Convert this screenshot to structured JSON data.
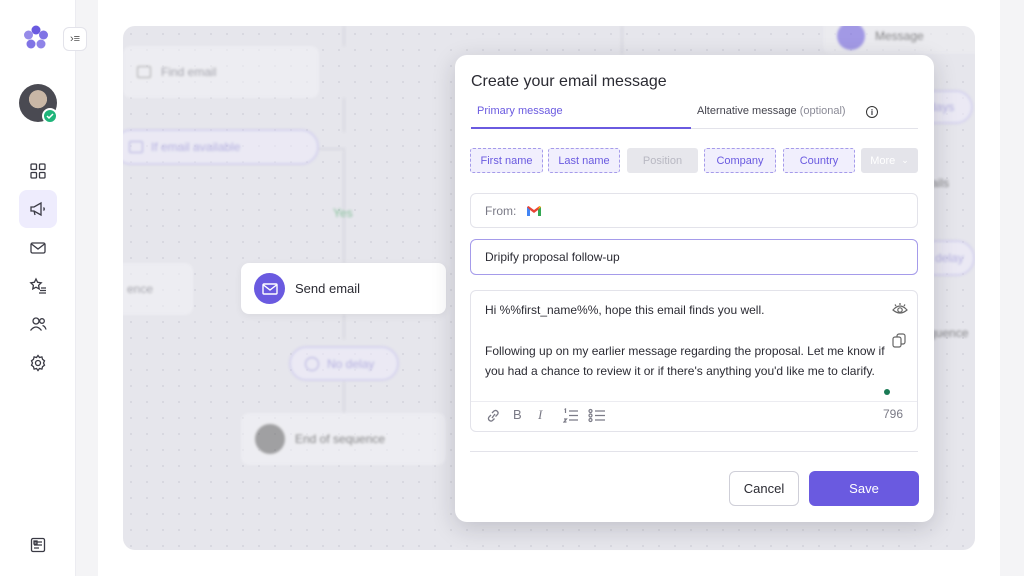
{
  "sidebar": {
    "collapse_glyph": "›≡",
    "nav": [
      "dashboard-icon",
      "megaphone-icon",
      "mail-icon",
      "star-list-icon",
      "users-icon",
      "gear-icon"
    ],
    "bottom": "report-icon"
  },
  "workflow": {
    "find_email": "Find email",
    "if_email_available": "If email available",
    "yes": "Yes",
    "sequence_left": "ence",
    "send_email": "Send email",
    "no_delay": "No delay",
    "end_of_sequence": "End of sequence",
    "right_message": "Message",
    "right_days": "days",
    "right_ails": "ails",
    "right_delay": "delay",
    "right_sequence": "quence"
  },
  "modal": {
    "title": "Create your email message",
    "tabs": {
      "primary": "Primary message",
      "alternative": "Alternative message",
      "alternative_opt": "(optional)",
      "info": "i"
    },
    "chips": [
      "First name",
      "Last name",
      "Position",
      "Company",
      "Country",
      "More"
    ],
    "from_label": "From:",
    "subject": "Dripify proposal follow-up",
    "body_line1": "Hi %%first_name%%, hope this email finds you well.",
    "body_line2": "Following up on my earlier message regarding the proposal. Let me know if you had a chance to review it or if there's anything you'd like me to clarify.",
    "char_count": "796",
    "toolbar": {
      "bold": "B",
      "italic": "I"
    },
    "cancel": "Cancel",
    "save": "Save"
  },
  "colors": {
    "accent": "#6a5ae0",
    "success": "#1fb57a"
  }
}
